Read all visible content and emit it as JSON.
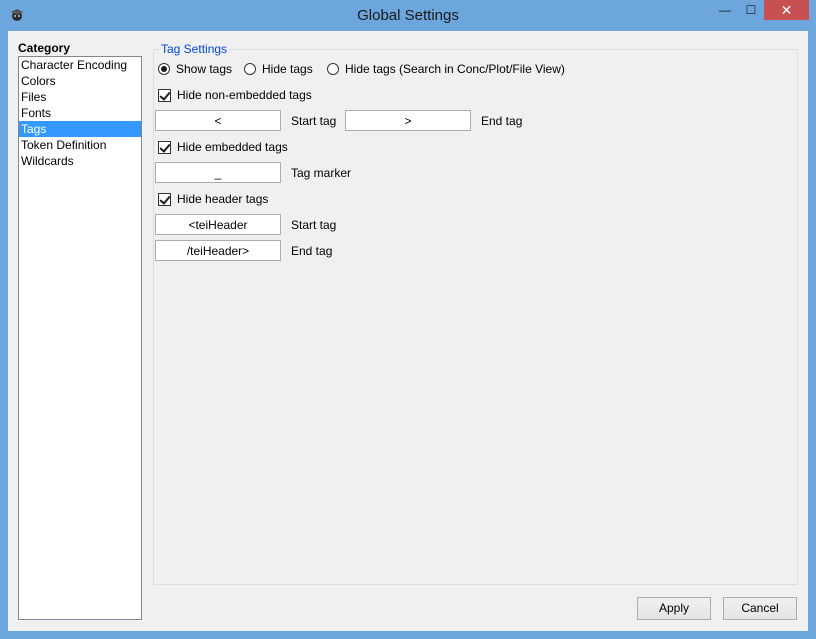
{
  "window": {
    "title": "Global Settings",
    "minimize_glyph": "—",
    "maximize_glyph": "☐",
    "close_glyph": "✕"
  },
  "category": {
    "label": "Category",
    "items": [
      {
        "label": "Character Encoding"
      },
      {
        "label": "Colors"
      },
      {
        "label": "Files"
      },
      {
        "label": "Fonts"
      },
      {
        "label": "Tags",
        "selected": true
      },
      {
        "label": "Token Definition"
      },
      {
        "label": "Wildcards"
      }
    ]
  },
  "tag_settings": {
    "group_title": "Tag Settings",
    "radios": [
      {
        "label": "Show tags",
        "checked": true
      },
      {
        "label": "Hide tags",
        "checked": false
      },
      {
        "label": "Hide tags (Search in Conc/Plot/File View)",
        "checked": false
      }
    ],
    "hide_non_embedded": {
      "label": "Hide non-embedded tags",
      "checked": true
    },
    "non_embedded_start": {
      "value": "<",
      "label": "Start tag"
    },
    "non_embedded_end": {
      "value": ">",
      "label": "End tag"
    },
    "hide_embedded": {
      "label": "Hide embedded tags",
      "checked": true
    },
    "embedded_marker": {
      "value": "_",
      "label": "Tag marker"
    },
    "hide_header": {
      "label": "Hide header tags",
      "checked": true
    },
    "header_start": {
      "value": "<teiHeader",
      "label": "Start tag"
    },
    "header_end": {
      "value": "/teiHeader>",
      "label": "End tag"
    }
  },
  "buttons": {
    "apply": "Apply",
    "cancel": "Cancel"
  },
  "colors": {
    "titlebar": "#6ca6dc",
    "close_button": "#c75050",
    "selection": "#3399ff",
    "group_title": "#0046d5"
  }
}
